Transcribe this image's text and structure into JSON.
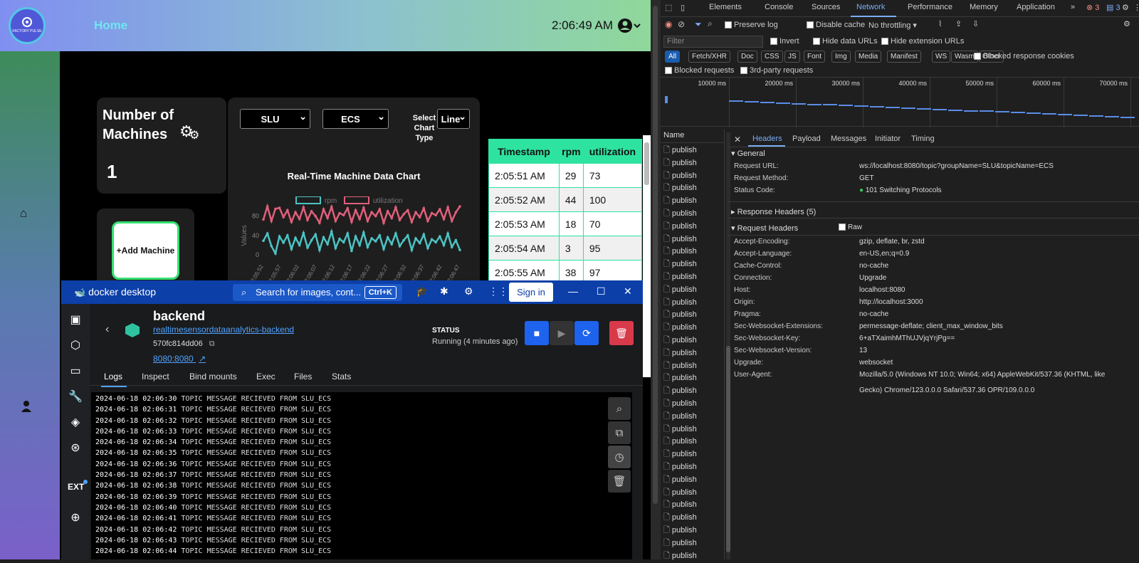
{
  "app": {
    "logo_text": "FACTORY PULSE",
    "nav_home": "Home",
    "clock": "2:06:49 AM",
    "machines_title": "Number of Machines",
    "machines_count": "1",
    "add_machine": "+Add Machine",
    "select_group": "SLU",
    "select_topic": "ECS",
    "select_type_label": "Select Chart Type",
    "select_type": "Line",
    "chart_title": "Real-Time Machine Data Chart",
    "table_headers": [
      "Timestamp",
      "rpm",
      "utilization"
    ],
    "table_rows": [
      [
        "2:05:51 AM",
        "29",
        "73"
      ],
      [
        "2:05:52 AM",
        "44",
        "100"
      ],
      [
        "2:05:53 AM",
        "18",
        "70"
      ],
      [
        "2:05:54 AM",
        "3",
        "95"
      ],
      [
        "2:05:55 AM",
        "38",
        "97"
      ]
    ]
  },
  "chart_data": {
    "type": "line",
    "title": "Real-Time Machine Data Chart",
    "ylabel": "Values",
    "ylim": [
      0,
      100
    ],
    "yticks": [
      0,
      40,
      80
    ],
    "xticks": [
      "2:05:52",
      "2:05:57",
      "2:06:02",
      "2:06:07",
      "2:06:12",
      "2:06:17",
      "2:06:22",
      "2:06:27",
      "2:06:32",
      "2:06:37",
      "2:06:42",
      "2:06:47"
    ],
    "legend_position": "top",
    "series": [
      {
        "name": "rpm",
        "color": "#4ec3c3",
        "values": [
          29,
          44,
          18,
          3,
          38,
          25,
          40,
          12,
          35,
          20,
          45,
          15,
          30,
          42,
          10,
          36,
          22,
          48,
          14,
          33,
          26,
          44,
          8,
          38,
          20,
          46,
          16,
          34,
          28,
          40,
          12,
          36,
          22,
          44,
          18,
          30,
          40,
          10,
          34,
          24,
          42,
          14,
          32,
          26,
          38,
          20,
          44,
          16,
          30,
          10
        ]
      },
      {
        "name": "utilization",
        "color": "#e0607a",
        "values": [
          73,
          100,
          70,
          95,
          97,
          78,
          92,
          68,
          88,
          74,
          98,
          72,
          90,
          80,
          66,
          94,
          76,
          99,
          70,
          86,
          82,
          96,
          68,
          92,
          74,
          97,
          70,
          88,
          80,
          94,
          66,
          90,
          76,
          98,
          72,
          84,
          92,
          68,
          88,
          78,
          96,
          70,
          86,
          82,
          94,
          74,
          98,
          70,
          88,
          100
        ]
      }
    ]
  },
  "docker": {
    "brand": "docker desktop",
    "search_placeholder": "Search for images, cont...",
    "search_shortcut": "Ctrl+K",
    "sign_in": "Sign in",
    "container_name": "backend",
    "image_link": "realtimesensordataanalytics-backend",
    "container_id": "570fc814dd06",
    "port_link": "8080:8080",
    "status_label": "STATUS",
    "status_value": "Running (4 minutes ago)",
    "ext_label": "EXT",
    "tabs": [
      "Logs",
      "Inspect",
      "Bind mounts",
      "Exec",
      "Files",
      "Stats"
    ],
    "log_message": "TOPIC MESSAGE RECIEVED FROM SLU_ECS",
    "log_timestamps": [
      "2024-06-18 02:06:30",
      "2024-06-18 02:06:31",
      "2024-06-18 02:06:32",
      "2024-06-18 02:06:33",
      "2024-06-18 02:06:34",
      "2024-06-18 02:06:35",
      "2024-06-18 02:06:36",
      "2024-06-18 02:06:37",
      "2024-06-18 02:06:38",
      "2024-06-18 02:06:39",
      "2024-06-18 02:06:40",
      "2024-06-18 02:06:41",
      "2024-06-18 02:06:42",
      "2024-06-18 02:06:43",
      "2024-06-18 02:06:44"
    ]
  },
  "devtools": {
    "tabs": [
      "Elements",
      "Console",
      "Sources",
      "Network",
      "Performance",
      "Memory",
      "Application"
    ],
    "errors": "3",
    "messages": "3",
    "preserve_log": "Preserve log",
    "disable_cache": "Disable cache",
    "throttling": "No throttling",
    "filter_placeholder": "Filter",
    "invert": "Invert",
    "hide_data": "Hide data URLs",
    "hide_ext": "Hide extension URLs",
    "type_filters": [
      "All",
      "Fetch/XHR",
      "Doc",
      "CSS",
      "JS",
      "Font",
      "Img",
      "Media",
      "Manifest",
      "WS",
      "Wasm",
      "Other"
    ],
    "blocked_cookies": "Blocked response cookies",
    "blocked_requests": "Blocked requests",
    "third_party": "3rd-party requests",
    "timeline_ticks": [
      "10000 ms",
      "20000 ms",
      "30000 ms",
      "40000 ms",
      "50000 ms",
      "60000 ms",
      "70000 ms"
    ],
    "name_header": "Name",
    "request_name": "publish",
    "request_count": 33,
    "detail_tabs": [
      "Headers",
      "Payload",
      "Messages",
      "Initiator",
      "Timing"
    ],
    "general_title": "General",
    "general": [
      [
        "Request URL:",
        "ws://localhost:8080/topic?groupName=SLU&topicName=ECS"
      ],
      [
        "Request Method:",
        "GET"
      ],
      [
        "Status Code:",
        "101 Switching Protocols"
      ]
    ],
    "response_headers_title": "Response Headers (5)",
    "request_headers_title": "Request Headers",
    "raw_label": "Raw",
    "request_headers": [
      [
        "Accept-Encoding:",
        "gzip, deflate, br, zstd"
      ],
      [
        "Accept-Language:",
        "en-US,en;q=0.9"
      ],
      [
        "Cache-Control:",
        "no-cache"
      ],
      [
        "Connection:",
        "Upgrade"
      ],
      [
        "Host:",
        "localhost:8080"
      ],
      [
        "Origin:",
        "http://localhost:3000"
      ],
      [
        "Pragma:",
        "no-cache"
      ],
      [
        "Sec-Websocket-Extensions:",
        "permessage-deflate; client_max_window_bits"
      ],
      [
        "Sec-Websocket-Key:",
        "6+aTXaimhMThUJVjqYrjPg=="
      ],
      [
        "Sec-Websocket-Version:",
        "13"
      ],
      [
        "Upgrade:",
        "websocket"
      ],
      [
        "User-Agent:",
        "Mozilla/5.0 (Windows NT 10.0; Win64; x64) AppleWebKit/537.36 (KHTML, like"
      ]
    ],
    "user_agent_cont": "Gecko) Chrome/123.0.0.0 Safari/537.36 OPR/109.0.0.0"
  }
}
